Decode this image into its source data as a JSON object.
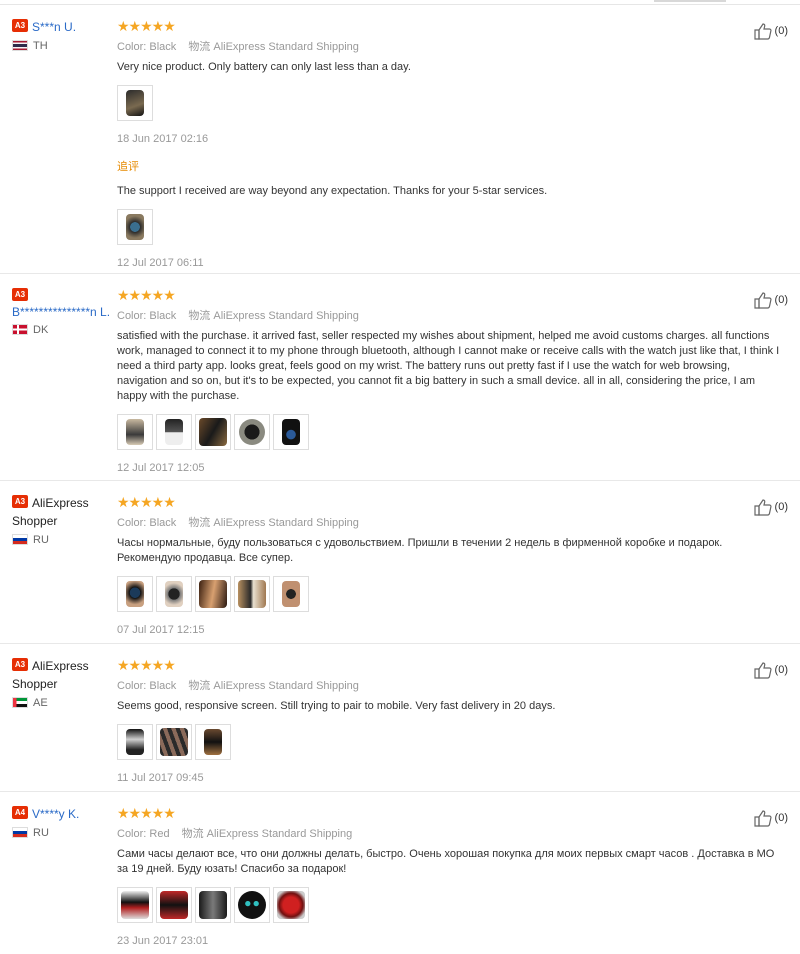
{
  "reviews": [
    {
      "level": "A3",
      "name": "S***n U.",
      "country": "TH",
      "color_label": "Color:",
      "color_value": "Black",
      "logistics_label": "物流",
      "logistics_value": "AliExpress Standard Shipping",
      "feedback": "Very nice product. Only battery can only last less than a day.",
      "date": "18 Jun 2017 02:16",
      "additional_label": "追评",
      "additional_feedback": "The support I received are way beyond any expectation. Thanks for your 5-star services.",
      "additional_date": "12 Jul 2017 06:11",
      "helpful_count": "(0)"
    },
    {
      "level": "A3",
      "name": "B***************n L.",
      "country": "DK",
      "color_label": "Color:",
      "color_value": "Black",
      "logistics_label": "物流",
      "logistics_value": "AliExpress Standard Shipping",
      "feedback": "satisfied with the purchase. it arrived fast, seller respected my wishes about shipment, helped me avoid customs charges. all functions work, managed to connect it to my phone through bluetooth, although I cannot make or receive calls with the watch just like that, I think I need a third party app. looks great, feels good on my wrist. The battery runs out pretty fast if I use the watch for web browsing, navigation and so on, but it's to be expected, you cannot fit a big battery in such a small device. all in all, considering the price, I am happy with the purchase.",
      "date": "12 Jul 2017 12:05",
      "helpful_count": "(0)"
    },
    {
      "level": "A3",
      "name": "AliExpress Shopper",
      "country": "RU",
      "color_label": "Color:",
      "color_value": "Black",
      "logistics_label": "物流",
      "logistics_value": "AliExpress Standard Shipping",
      "feedback": "Часы нормальные, буду пользоваться с удовольствием. Пришли в течении 2 недель в фирменной коробке и подарок. Рекомендую продавца. Все супер.",
      "date": "07 Jul 2017 12:15",
      "helpful_count": "(0)"
    },
    {
      "level": "A3",
      "name": "AliExpress Shopper",
      "country": "AE",
      "color_label": "Color:",
      "color_value": "Black",
      "logistics_label": "物流",
      "logistics_value": "AliExpress Standard Shipping",
      "feedback": "Seems good, responsive screen. Still trying to pair to mobile. Very fast delivery in 20 days.",
      "date": "11 Jul 2017 09:45",
      "helpful_count": "(0)"
    },
    {
      "level": "A4",
      "name": "V****y K.",
      "country": "RU",
      "color_label": "Color:",
      "color_value": "Red",
      "logistics_label": "物流",
      "logistics_value": "AliExpress Standard Shipping",
      "feedback": "Сами часы делают все, что они должны делать, быстро. Очень хорошая покупка для моих первых смарт часов . Доставка в МО за 19 дней. Буду юзать! Спасибо за подарок!",
      "date": "23 Jun 2017 23:01",
      "helpful_count": "(0)"
    }
  ],
  "stars_text": "★★★★★",
  "colors": {
    "star": "#f5a623",
    "badge": "#e62e04",
    "username_link": "#2a6ac7",
    "additional_label": "#e68a00"
  },
  "icons": {
    "helpful": "thumbs-up-icon",
    "rating": "star-icon"
  }
}
